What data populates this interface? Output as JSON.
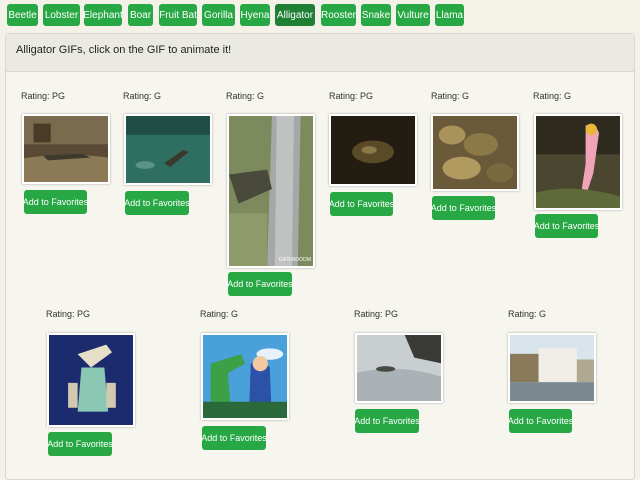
{
  "nav": {
    "buttons": [
      "Beetle",
      "Lobster",
      "Elephant",
      "Boar",
      "Fruit Bat",
      "Gorilla",
      "Hyena",
      "Alligator",
      "Rooster",
      "Snake",
      "Vulture",
      "Llama"
    ],
    "selected": "Alligator"
  },
  "panel": {
    "heading": "Alligator GIFs, click on the GIF to animate it!"
  },
  "gifs": [
    {
      "rating": "Rating: PG",
      "button": "Add to Favorites",
      "subject": "alligator on path"
    },
    {
      "rating": "Rating: G",
      "button": "Add to Favorites",
      "subject": "alligator swimming in pool"
    },
    {
      "rating": "Rating: G",
      "button": "Add to Favorites",
      "subject": "alligator climbing door",
      "caption": "GIFBINDOOM"
    },
    {
      "rating": "Rating: PG",
      "button": "Add to Favorites",
      "subject": "baby alligators in dark"
    },
    {
      "rating": "Rating: G",
      "button": "Add to Favorites",
      "subject": "pile of baby alligators"
    },
    {
      "rating": "Rating: G",
      "button": "Add to Favorites",
      "subject": "cartoon girl with alligator"
    },
    {
      "rating": "Rating: PG",
      "button": "Add to Favorites",
      "subject": "cartoon robot alligator"
    },
    {
      "rating": "Rating: G",
      "button": "Add to Favorites",
      "subject": "cartoon alligator and boy"
    },
    {
      "rating": "Rating: PG",
      "button": "Add to Favorites",
      "subject": "alligator in water"
    },
    {
      "rating": "Rating: G",
      "button": "Add to Favorites",
      "subject": "building by the water"
    }
  ]
}
